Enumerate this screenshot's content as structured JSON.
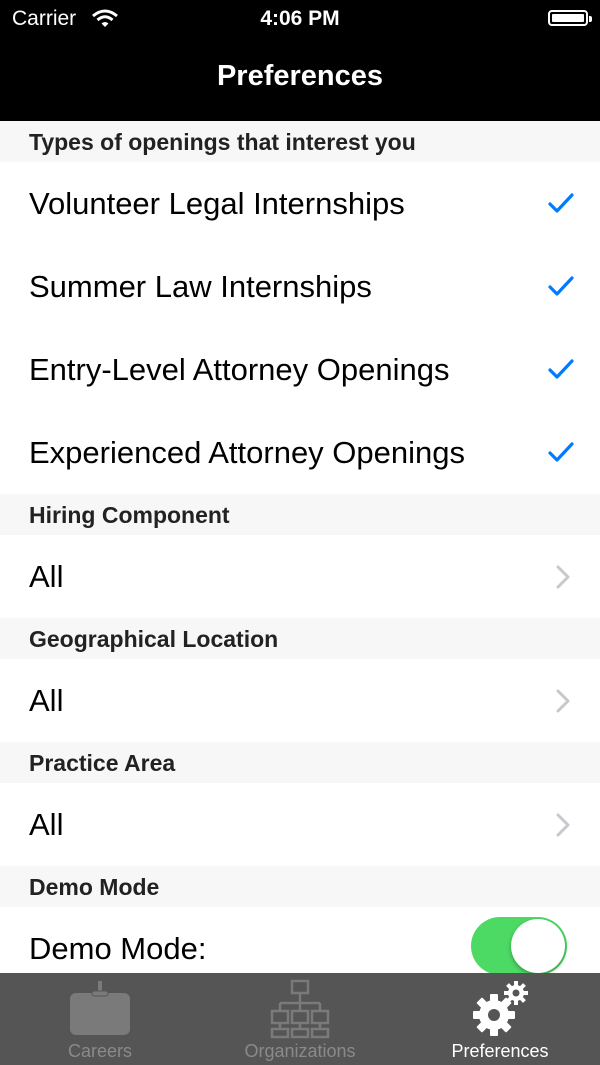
{
  "status_bar": {
    "carrier": "Carrier",
    "time": "4:06 PM"
  },
  "nav": {
    "title": "Preferences"
  },
  "sections": {
    "openings": {
      "header": "Types of openings that interest you",
      "items": [
        {
          "label": "Volunteer Legal Internships",
          "checked": true
        },
        {
          "label": "Summer Law Internships",
          "checked": true
        },
        {
          "label": "Entry-Level Attorney Openings",
          "checked": true
        },
        {
          "label": "Experienced Attorney Openings",
          "checked": true
        }
      ]
    },
    "hiring_component": {
      "header": "Hiring Component",
      "value": "All"
    },
    "geographical_location": {
      "header": "Geographical Location",
      "value": "All"
    },
    "practice_area": {
      "header": "Practice Area",
      "value": "All"
    },
    "demo_mode": {
      "header": "Demo Mode",
      "label": "Demo Mode:",
      "enabled": true
    }
  },
  "tabbar": {
    "tabs": [
      {
        "label": "Careers",
        "icon": "briefcase-icon",
        "active": false
      },
      {
        "label": "Organizations",
        "icon": "org-chart-icon",
        "active": false
      },
      {
        "label": "Preferences",
        "icon": "gears-icon",
        "active": true
      }
    ]
  },
  "colors": {
    "accent": "#007aff",
    "toggle_on": "#4cd964",
    "tabbar": "#555555"
  }
}
